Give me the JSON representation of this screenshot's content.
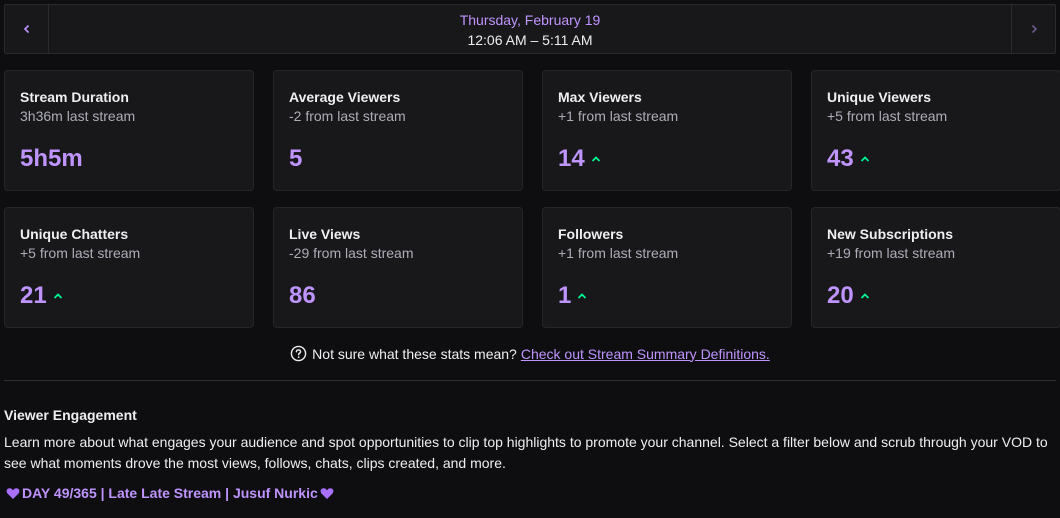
{
  "date_header": {
    "day": "Thursday, February 19",
    "time_range": "12:06 AM – 5:11 AM",
    "prev_icon": "chevron-left-icon",
    "next_icon": "chevron-right-icon"
  },
  "cards": [
    {
      "title": "Stream Duration",
      "subtitle": "3h36m last stream",
      "value": "5h5m",
      "trend": "none"
    },
    {
      "title": "Average Viewers",
      "subtitle": "-2 from last stream",
      "value": "5",
      "trend": "none"
    },
    {
      "title": "Max Viewers",
      "subtitle": "+1 from last stream",
      "value": "14",
      "trend": "up"
    },
    {
      "title": "Unique Viewers",
      "subtitle": "+5 from last stream",
      "value": "43",
      "trend": "up"
    },
    {
      "title": "Unique Chatters",
      "subtitle": "+5 from last stream",
      "value": "21",
      "trend": "up"
    },
    {
      "title": "Live Views",
      "subtitle": "-29 from last stream",
      "value": "86",
      "trend": "none"
    },
    {
      "title": "Followers",
      "subtitle": "+1 from last stream",
      "value": "1",
      "trend": "up"
    },
    {
      "title": "New Subscriptions",
      "subtitle": "+19 from last stream",
      "value": "20",
      "trend": "up"
    }
  ],
  "help": {
    "text": "Not sure what these stats mean?",
    "link": "Check out Stream Summary Definitions."
  },
  "engagement": {
    "title": "Viewer Engagement",
    "description": "Learn more about what engages your audience and spot opportunities to clip top highlights to promote your channel. Select a filter below and scrub through your VOD to see what moments drove the most views, follows, chats, clips created, and more.",
    "stream_title": "DAY 49/365 | Late Late Stream | Jusuf Nurkic"
  },
  "colors": {
    "accent": "#bf94ff",
    "up_trend": "#00f593",
    "card_bg": "#18181b",
    "page_bg": "#0e0e10"
  }
}
